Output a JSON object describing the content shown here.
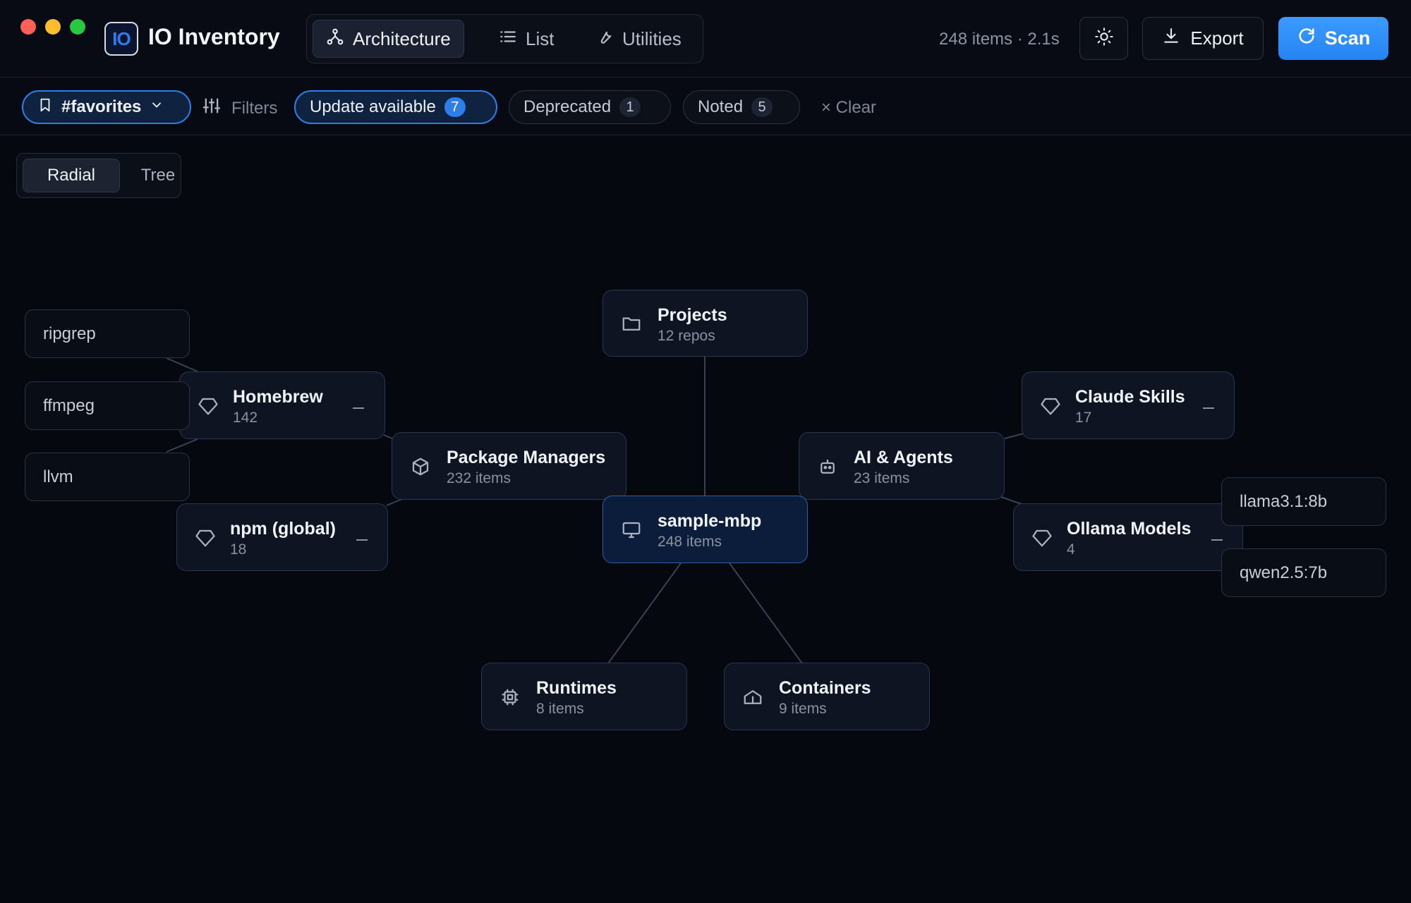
{
  "app": {
    "title": "IO Inventory",
    "logo_text": "IO"
  },
  "view_tabs": [
    {
      "label": "Architecture",
      "icon": "network-icon",
      "active": true
    },
    {
      "label": "List",
      "icon": "list-icon",
      "active": false
    },
    {
      "label": "Utilities",
      "icon": "wrench-icon",
      "active": false
    }
  ],
  "stats": "248 items · 2.1s",
  "toolbar": {
    "theme_icon": "sun-icon",
    "export_label": "Export",
    "scan_label": "Scan"
  },
  "filters": {
    "saved_view": "#favorites",
    "filters_label": "Filters",
    "chips": [
      {
        "label": "Update available",
        "count": "7",
        "active": true
      },
      {
        "label": "Deprecated",
        "count": "1",
        "active": false
      },
      {
        "label": "Noted",
        "count": "5",
        "active": false
      }
    ],
    "clear_label": "× Clear"
  },
  "layout_toggle": {
    "options": [
      "Radial",
      "Tree"
    ],
    "selected": "Radial"
  },
  "graph": {
    "center": {
      "name": "sample-mbp",
      "sub": "248 items",
      "icon": "monitor-icon"
    },
    "projects": {
      "name": "Projects",
      "sub": "12 repos",
      "icon": "folder-icon"
    },
    "package_managers": {
      "name": "Package Managers",
      "sub": "232 items",
      "icon": "box-icon"
    },
    "ai_agents": {
      "name": "AI & Agents",
      "sub": "23 items",
      "icon": "robot-icon"
    },
    "runtimes": {
      "name": "Runtimes",
      "sub": "8 items",
      "icon": "chip-icon"
    },
    "containers": {
      "name": "Containers",
      "sub": "9 items",
      "icon": "container-icon"
    },
    "homebrew": {
      "name": "Homebrew",
      "sub": "142",
      "icon": "gem-icon"
    },
    "npm": {
      "name": "npm (global)",
      "sub": "18",
      "icon": "gem-icon"
    },
    "claude_skills": {
      "name": "Claude Skills",
      "sub": "17",
      "icon": "gem-icon"
    },
    "ollama": {
      "name": "Ollama Models",
      "sub": "4",
      "icon": "gem-icon"
    },
    "homebrew_leaves": [
      "ripgrep",
      "ffmpeg",
      "llvm"
    ],
    "ollama_leaves": [
      "llama3.1:8b",
      "qwen2.5:7b"
    ]
  },
  "colors": {
    "accent": "#2f7de8",
    "background": "#06080f",
    "node_bg": "#0e1422",
    "edge": "#3a4152"
  }
}
